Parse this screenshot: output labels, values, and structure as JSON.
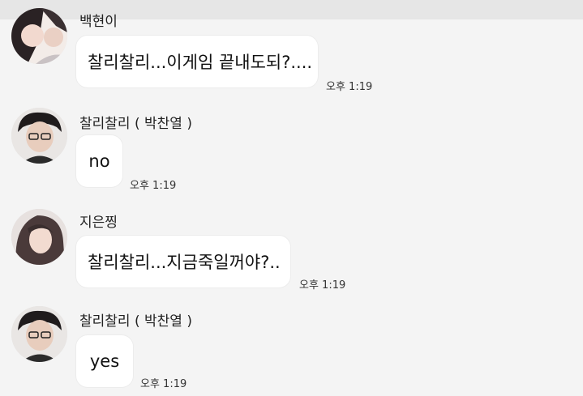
{
  "messages": [
    {
      "sender": "백현이",
      "text": "찰리찰리...이게임 끝내도되?....",
      "time": "오후 1:19"
    },
    {
      "sender": "찰리찰리 ( 박찬열 )",
      "text": "no",
      "time": "오후 1:19"
    },
    {
      "sender": "지은찡",
      "text": "찰리찰리...지금죽일꺼야?..",
      "time": "오후 1:19"
    },
    {
      "sender": "찰리찰리 ( 박찬열 )",
      "text": "yes",
      "time": "오후 1:19"
    }
  ]
}
